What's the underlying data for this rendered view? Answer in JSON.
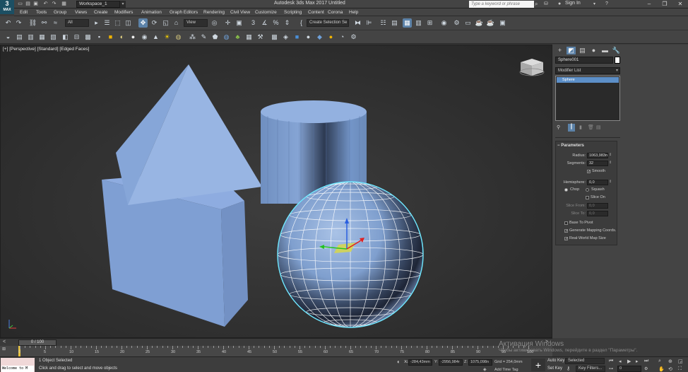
{
  "app": {
    "logo_text": "3",
    "logo_sub": "MAX",
    "title": "Autodesk 3ds Max 2017      Untitled",
    "workspace": "Workspace_1",
    "search_placeholder": "Type a keyword or phrase",
    "signin": "Sign In"
  },
  "menu": [
    "Edit",
    "Tools",
    "Group",
    "Views",
    "Create",
    "Modifiers",
    "Animation",
    "Graph Editors",
    "Rendering",
    "Civil View",
    "Customize",
    "Scripting",
    "Content",
    "Corona",
    "Help"
  ],
  "toolbar": {
    "filter_dropdown": "All",
    "view_dropdown": "View",
    "selection_set": "Create Selection Se"
  },
  "viewport": {
    "label": "[+] [Perspective] [Standard] [Edged Faces]"
  },
  "command_panel": {
    "object_name": "Sphere001",
    "modifier_list": "Modifier List",
    "stack_item": "Sphere",
    "rollout_title": "Parameters",
    "radius_label": "Radius:",
    "radius_value": "1063,983n",
    "segments_label": "Segments:",
    "segments_value": "32",
    "smooth_label": "Smooth",
    "hemisphere_label": "Hemisphere:",
    "hemisphere_value": "0,0",
    "chop_label": "Chop",
    "squash_label": "Squash",
    "slice_on_label": "Slice On",
    "slice_from_label": "Slice From:",
    "slice_from_value": "0,0",
    "slice_to_label": "Slice To:",
    "slice_to_value": "0,0",
    "base_to_pivot_label": "Base To Pivot",
    "gen_mapping_label": "Generate Mapping Coords.",
    "real_world_label": "Real-World Map Size"
  },
  "timeline": {
    "frame_display": "0 / 100",
    "ticks": [
      "0",
      "5",
      "10",
      "15",
      "20",
      "25",
      "30",
      "35",
      "40",
      "45",
      "50",
      "55",
      "60",
      "65",
      "70",
      "75",
      "80",
      "85",
      "90",
      "95",
      "100"
    ]
  },
  "status": {
    "maxscript_text": "Welcome to M",
    "selected": "1 Object Selected",
    "prompt": "Click and drag to select and move objects",
    "x_label": "X:",
    "x_value": "-284,43mm",
    "y_label": "Y:",
    "y_value": "-2956,984r",
    "z_label": "Z:",
    "z_value": "1075,098n",
    "grid": "Grid = 254,0mm",
    "add_time_tag": "Add Time Tag",
    "auto_key": "Auto Key",
    "selected_dd": "Selected",
    "set_key": "Set Key",
    "key_filters": "Key Filters...",
    "frame_value": "0"
  },
  "watermark": {
    "line1": "Активация Windows",
    "line2": "Чтобы активировать Windows, перейдите в раздел \"Параметры\"."
  },
  "colors": {
    "accent": "#5c82a8",
    "selection_highlight": "#5c8fc8",
    "object_blue": "#7a9ed0",
    "viewport_bg": "#2f2f2f"
  }
}
